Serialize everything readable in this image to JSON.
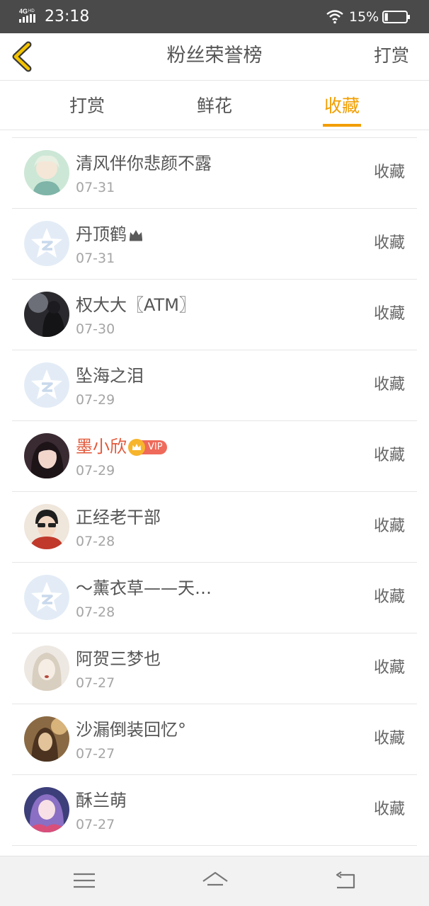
{
  "status_bar": {
    "network": "4G HD",
    "time": "23:18",
    "battery_percent": "15%",
    "battery_level": 0.15
  },
  "header": {
    "back_icon": "chevron-left-icon",
    "title": "粉丝荣誉榜",
    "action_label": "打赏"
  },
  "tabs": [
    {
      "label": "打赏",
      "active": false
    },
    {
      "label": "鲜花",
      "active": false
    },
    {
      "label": "收藏",
      "active": true
    }
  ],
  "colors": {
    "accent": "#f29e00",
    "vip_name": "#e2583a",
    "vip_badge": "#ef6a5a",
    "status_bar": "#4a4a4a"
  },
  "fans": [
    {
      "name": "清风伴你悲颜不露",
      "date": "07-31",
      "action": "收藏",
      "avatar": "anime-boy-avatar"
    },
    {
      "name": "丹顶鹤",
      "date": "07-31",
      "action": "收藏",
      "avatar": "default-star-avatar",
      "crown": true
    },
    {
      "name": "权大大〖ATM〗",
      "date": "07-30",
      "action": "收藏",
      "avatar": "dark-girl-avatar"
    },
    {
      "name": "坠海之泪",
      "date": "07-29",
      "action": "收藏",
      "avatar": "default-star-avatar"
    },
    {
      "name": "墨小欣",
      "date": "07-29",
      "action": "收藏",
      "avatar": "girl-photo-avatar",
      "vip": true,
      "vip_label": "VIP"
    },
    {
      "name": "正经老干部",
      "date": "07-28",
      "action": "收藏",
      "avatar": "sunglasses-boy-avatar"
    },
    {
      "name": "～薰衣草——天…",
      "date": "07-28",
      "action": "收藏",
      "avatar": "default-star-avatar"
    },
    {
      "name": "阿贺三梦也",
      "date": "07-27",
      "action": "收藏",
      "avatar": "pale-girl-avatar"
    },
    {
      "name": "沙漏倒装回忆°",
      "date": "07-27",
      "action": "收藏",
      "avatar": "sepia-girl-avatar"
    },
    {
      "name": "酥兰萌",
      "date": "07-27",
      "action": "收藏",
      "avatar": "anime-girl-avatar"
    }
  ],
  "navbar": {
    "menu_icon": "menu-icon",
    "home_icon": "home-icon",
    "back_icon": "return-icon"
  }
}
